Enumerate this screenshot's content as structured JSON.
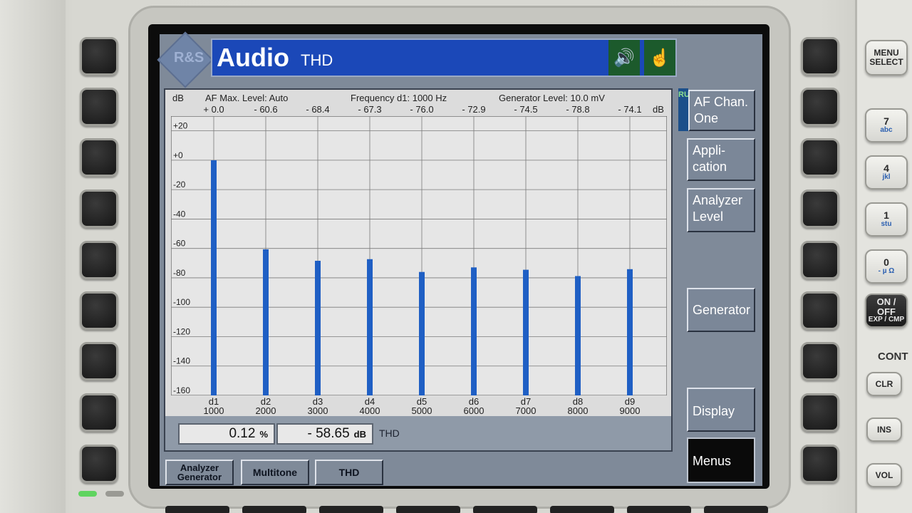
{
  "title": {
    "main": "Audio",
    "sub": "THD"
  },
  "logo": {
    "text": "R&S"
  },
  "icons": {
    "speaker": "speaker-icon",
    "touch": "touch-icon"
  },
  "header": {
    "unit_left": "dB",
    "af_max_level": "AF Max. Level:  Auto",
    "frequency": "Frequency d1:  1000  Hz",
    "generator_level": "Generator Level:  10.0  mV",
    "unit_right": "dB"
  },
  "chart_data": {
    "type": "bar",
    "categories": [
      "d1",
      "d2",
      "d3",
      "d4",
      "d5",
      "d6",
      "d7",
      "d8",
      "d9"
    ],
    "frequencies": [
      "1000",
      "2000",
      "3000",
      "4000",
      "5000",
      "6000",
      "7000",
      "8000",
      "9000"
    ],
    "top_labels": [
      "+ 0.0",
      "- 60.6",
      "- 68.4",
      "- 67.3",
      "- 76.0",
      "- 72.9",
      "- 74.5",
      "- 78.8",
      "- 74.1"
    ],
    "values": [
      0.0,
      -60.6,
      -68.4,
      -67.3,
      -76.0,
      -72.9,
      -74.5,
      -78.8,
      -74.1
    ],
    "ylim": [
      -160,
      30
    ],
    "y_ticks": [
      "+20",
      "+0",
      "-20",
      "-40",
      "-60",
      "-80",
      "-100",
      "-120",
      "-140",
      "-160"
    ],
    "ylabel": "dB",
    "grid": true,
    "bar_color": "#1f5fc4"
  },
  "readouts": {
    "percent_value": "0.12",
    "percent_unit": "%",
    "db_value": "- 58.65",
    "db_unit": "dB",
    "label": "THD"
  },
  "side_menu": {
    "run": "RUN",
    "items": [
      "AF Chan. One",
      "Appli- cation",
      "Analyzer Level",
      "Generator",
      "Display",
      "Menus"
    ]
  },
  "bottom_tabs": [
    "Analyzer Generator",
    "Multitone",
    "THD"
  ],
  "hardware": {
    "menu_select": "MENU SELECT",
    "k7": "7",
    "k7_sub": "abc",
    "k4": "4",
    "k4_sub": "jkl",
    "k1": "1",
    "k1_sub": "stu",
    "k0": "0",
    "k0_sub": "- µ Ω",
    "onoff": "ON / OFF",
    "onoff_sub": "EXP / CMP",
    "cont": "CONT",
    "clr": "CLR",
    "ins": "INS",
    "vol": "VOL"
  }
}
